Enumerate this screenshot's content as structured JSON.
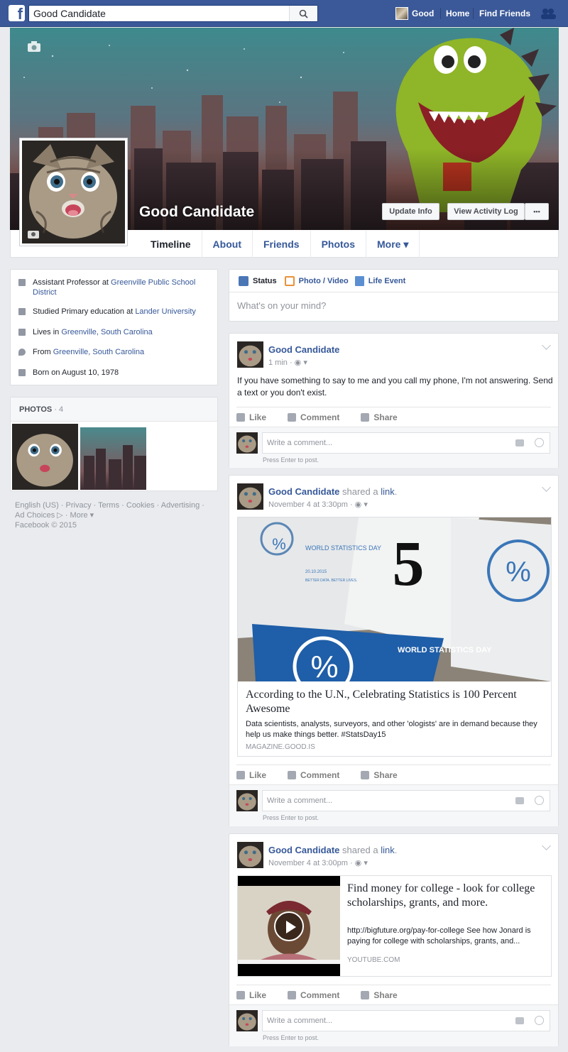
{
  "topbar": {
    "search_value": "Good Candidate",
    "profile_label": "Good",
    "home_label": "Home",
    "find_friends_label": "Find Friends"
  },
  "profile": {
    "name": "Good Candidate",
    "update_info": "Update Info",
    "view_activity_log": "View Activity Log",
    "more_dots": "•••",
    "tabs": [
      "Timeline",
      "About",
      "Friends",
      "Photos",
      "More ▾"
    ]
  },
  "intro": {
    "job_prefix": "Assistant Professor at ",
    "job_link": "Greenville Public School District",
    "studied_prefix": "Studied Primary education at ",
    "studied_link": "Lander University",
    "lives_prefix": "Lives in ",
    "lives_link": "Greenville, South Carolina",
    "from_prefix": "From ",
    "from_link": "Greenville, South Carolina",
    "born": "Born on August 10, 1978"
  },
  "photos": {
    "label": "PHOTOS",
    "count": " · 4"
  },
  "footer": {
    "line1": "English (US) · Privacy · Terms · Cookies · Advertising ·",
    "line2": "Ad Choices ▷ · More ▾",
    "line3": "Facebook © 2015"
  },
  "composer": {
    "status": "Status",
    "photo_video": "Photo / Video",
    "life_event": "Life Event",
    "placeholder": "What's on your mind?"
  },
  "common": {
    "like": "Like",
    "comment": "Comment",
    "share": "Share",
    "write_comment": "Write a comment...",
    "press_enter": "Press Enter to post.",
    "shared_a": " shared a ",
    "link_word": "link",
    "period": "."
  },
  "posts": [
    {
      "author": "Good Candidate",
      "time": "1 min · ◉ ▾",
      "text": "If you have something to say to me and you call my phone, I'm not answering. Send a text or you don't exist."
    },
    {
      "author": "Good Candidate",
      "time": "November 4 at 3:30pm · ◉ ▾",
      "link_title": "According to the U.N., Celebrating Statistics is 100 Percent Awesome",
      "link_desc": "Data scientists, analysts, surveyors, and other 'ologists' are in demand because they help us make things better. #StatsDay15",
      "link_source": "MAGAZINE.GOOD.IS",
      "img_text1": "WORLD STATISTICS DAY",
      "img_text2": "20.10.2015",
      "img_text3": "BETTER DATA. BETTER LIVES.",
      "img_big": "5"
    },
    {
      "author": "Good Candidate",
      "time": "November 4 at 3:00pm · ◉ ▾",
      "link_title": "Find money for college - look for college scholarships, grants, and more.",
      "link_desc": "http://bigfuture.org/pay-for-college See how Jonard is paying for college with scholarships, grants, and...",
      "link_source": "YOUTUBE.COM"
    }
  ],
  "colors": {
    "brand": "#3b5998",
    "link": "#365899",
    "page_bg": "#e9ebee"
  }
}
